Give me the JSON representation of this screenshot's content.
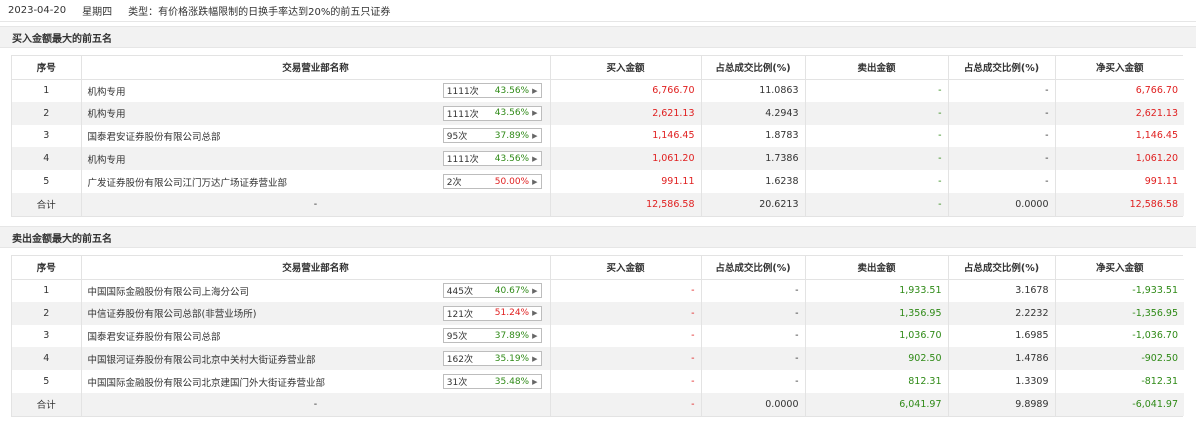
{
  "header": {
    "date": "2023-04-20",
    "weekday": "星期四",
    "type_text": "类型：有价格涨跌幅限制的日换手率达到20%的前五只证券"
  },
  "columns": [
    "序号",
    "交易营业部名称",
    "买入金额",
    "占总成交比例(%)",
    "卖出金额",
    "占总成交比例(%)",
    "净买入金额"
  ],
  "colors": {
    "red": "#e02020",
    "green": "#2f8a17",
    "stripe": "#f2f2f2",
    "border": "#e3e3e3"
  },
  "buy_section": {
    "title": "买入金额最大的前五名",
    "rows": [
      {
        "idx": "1",
        "name": "机构专用",
        "count": "1111次",
        "pct": "43.56%",
        "pct_color": "green",
        "buy": "6,766.70",
        "buy_ratio": "11.0863",
        "sell": "-",
        "sell_ratio": "-",
        "net": "6,766.70"
      },
      {
        "idx": "2",
        "name": "机构专用",
        "count": "1111次",
        "pct": "43.56%",
        "pct_color": "green",
        "buy": "2,621.13",
        "buy_ratio": "4.2943",
        "sell": "-",
        "sell_ratio": "-",
        "net": "2,621.13"
      },
      {
        "idx": "3",
        "name": "国泰君安证券股份有限公司总部",
        "count": "95次",
        "pct": "37.89%",
        "pct_color": "green",
        "buy": "1,146.45",
        "buy_ratio": "1.8783",
        "sell": "-",
        "sell_ratio": "-",
        "net": "1,146.45"
      },
      {
        "idx": "4",
        "name": "机构专用",
        "count": "1111次",
        "pct": "43.56%",
        "pct_color": "green",
        "buy": "1,061.20",
        "buy_ratio": "1.7386",
        "sell": "-",
        "sell_ratio": "-",
        "net": "1,061.20"
      },
      {
        "idx": "5",
        "name": "广发证券股份有限公司江门万达广场证券营业部",
        "count": "2次",
        "pct": "50.00%",
        "pct_color": "red",
        "buy": "991.11",
        "buy_ratio": "1.6238",
        "sell": "-",
        "sell_ratio": "-",
        "net": "991.11"
      }
    ],
    "total": {
      "label": "合计",
      "name": "-",
      "buy": "12,586.58",
      "buy_ratio": "20.6213",
      "sell": "-",
      "sell_ratio": "0.0000",
      "net": "12,586.58"
    }
  },
  "sell_section": {
    "title": "卖出金额最大的前五名",
    "rows": [
      {
        "idx": "1",
        "name": "中国国际金融股份有限公司上海分公司",
        "count": "445次",
        "pct": "40.67%",
        "pct_color": "green",
        "buy": "-",
        "buy_ratio": "-",
        "sell": "1,933.51",
        "sell_ratio": "3.1678",
        "net": "-1,933.51"
      },
      {
        "idx": "2",
        "name": "中信证券股份有限公司总部(非营业场所)",
        "count": "121次",
        "pct": "51.24%",
        "pct_color": "red",
        "buy": "-",
        "buy_ratio": "-",
        "sell": "1,356.95",
        "sell_ratio": "2.2232",
        "net": "-1,356.95"
      },
      {
        "idx": "3",
        "name": "国泰君安证券股份有限公司总部",
        "count": "95次",
        "pct": "37.89%",
        "pct_color": "green",
        "buy": "-",
        "buy_ratio": "-",
        "sell": "1,036.70",
        "sell_ratio": "1.6985",
        "net": "-1,036.70"
      },
      {
        "idx": "4",
        "name": "中国银河证券股份有限公司北京中关村大街证券营业部",
        "count": "162次",
        "pct": "35.19%",
        "pct_color": "green",
        "buy": "-",
        "buy_ratio": "-",
        "sell": "902.50",
        "sell_ratio": "1.4786",
        "net": "-902.50"
      },
      {
        "idx": "5",
        "name": "中国国际金融股份有限公司北京建国门外大街证券营业部",
        "count": "31次",
        "pct": "35.48%",
        "pct_color": "green",
        "buy": "-",
        "buy_ratio": "-",
        "sell": "812.31",
        "sell_ratio": "1.3309",
        "net": "-812.31"
      }
    ],
    "total": {
      "label": "合计",
      "name": "-",
      "buy": "-",
      "buy_ratio": "0.0000",
      "sell": "6,041.97",
      "sell_ratio": "9.8989",
      "net": "-6,041.97"
    }
  }
}
